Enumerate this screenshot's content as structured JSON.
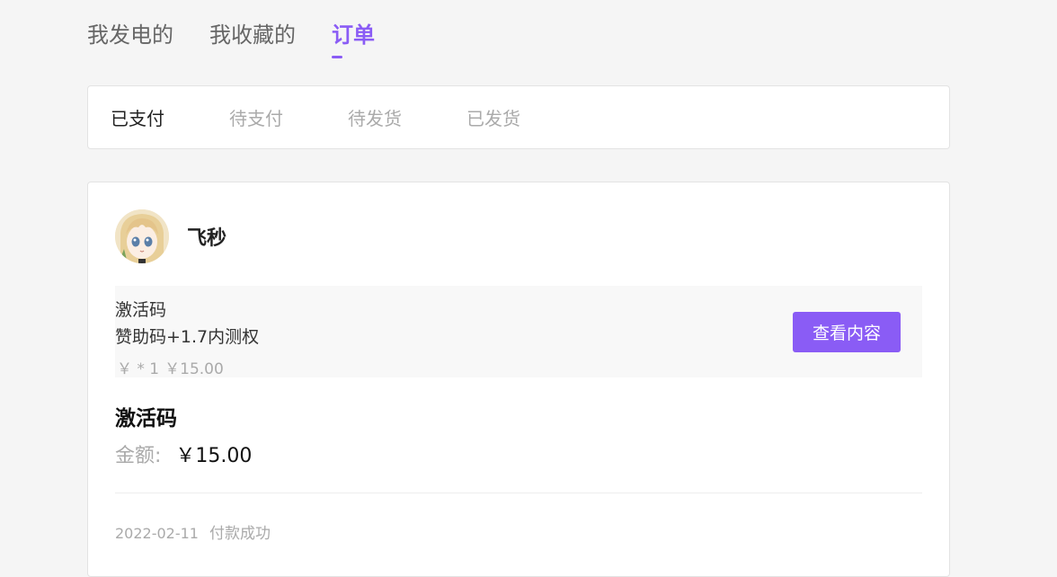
{
  "top_tabs": [
    {
      "label": "我发电的"
    },
    {
      "label": "我收藏的"
    },
    {
      "label": "订单",
      "active": true
    }
  ],
  "status_tabs": [
    {
      "label": "已支付",
      "active": true
    },
    {
      "label": "待支付"
    },
    {
      "label": "待发货"
    },
    {
      "label": "已发货"
    }
  ],
  "order": {
    "seller_name": "飞秒",
    "item": {
      "title": "激活码",
      "description": "赞助码+1.7内测权",
      "price_prefix": "￥ * 1",
      "price": "￥15.00"
    },
    "view_button_label": "查看内容",
    "product_name": "激活码",
    "amount_label": "金额:",
    "amount_value": "￥15.00",
    "date": "2022-02-11",
    "status": "付款成功"
  },
  "colors": {
    "accent": "#8a5cf5",
    "background": "#f5f5f5"
  }
}
